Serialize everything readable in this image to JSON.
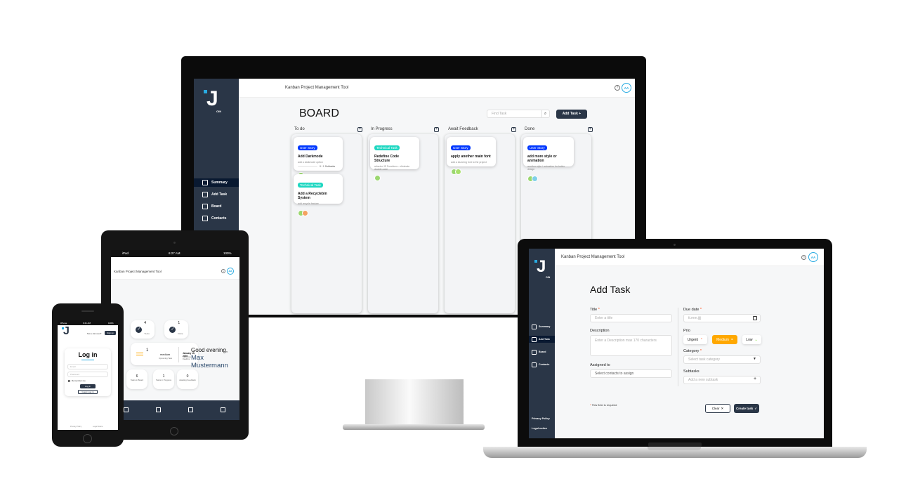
{
  "colors": {
    "sidebar": "#2a3647",
    "accent": "#29abe2",
    "user_story": "#0038ff",
    "technical_task": "#1fd7c1",
    "medium": "#ffa800"
  },
  "app": {
    "title": "Kanban Project Management Tool",
    "logo_text": "OIN",
    "user_initials": "AA",
    "help": "?"
  },
  "desktop": {
    "nav": [
      {
        "label": "Summary",
        "icon": "summary-icon"
      },
      {
        "label": "Add Task",
        "icon": "add-task-icon"
      },
      {
        "label": "Board",
        "icon": "board-icon"
      },
      {
        "label": "Contacts",
        "icon": "contacts-icon"
      }
    ],
    "board_title": "BOARD",
    "search_placeholder": "Find Task",
    "add_task_button": "Add Task +",
    "columns": [
      {
        "title": "To do",
        "cards": [
          {
            "category": "User Story",
            "title": "Add Darkmode",
            "desc": "add a darkmode option",
            "progress": "0 / 1 Subtasks"
          },
          {
            "category": "Technical Task",
            "title": "Add a Recyclebin System",
            "desc": "add recycle feature"
          }
        ]
      },
      {
        "title": "In Progress",
        "cards": [
          {
            "category": "Technical Task",
            "title": "Redefine Code Structure",
            "desc": "refactor JS Functions - eliminate double code"
          }
        ]
      },
      {
        "title": "Await Feedback",
        "cards": [
          {
            "category": "User Story",
            "title": "apply another main font",
            "desc": "add a stunning font to the project"
          }
        ]
      },
      {
        "title": "Done",
        "cards": [
          {
            "category": "User Story",
            "title": "add more style or animation",
            "desc": "another style / animation for better design"
          }
        ]
      }
    ]
  },
  "tablet": {
    "status_left": "iPad",
    "status_time": "6:27 AM",
    "status_right": "100%",
    "tiles": [
      {
        "value": "4",
        "label": "To-do"
      },
      {
        "value": "1",
        "label": "Done"
      }
    ],
    "urgent": {
      "value": "1",
      "prio": "medium",
      "sub": "Upcoming Task",
      "date": "January 15, 2026",
      "date_sub": "Upcoming Deadline"
    },
    "stats": [
      {
        "value": "6",
        "label": "Tasks in Board"
      },
      {
        "value": "1",
        "label": "Tasks in Progress"
      },
      {
        "value": "0",
        "label": "Awaiting Feedback"
      }
    ],
    "greeting": "Good evening,",
    "name": "Max Mustermann"
  },
  "phone": {
    "status_left": "iPhone",
    "status_time": "9:41 AM",
    "status_right": "100%",
    "signup_prompt": "Not a Join user?",
    "signup_button": "Sign up",
    "title": "Log in",
    "email_placeholder": "Email",
    "password_placeholder": "Password",
    "remember": "Remember me",
    "login_button": "Log in",
    "guest_button": "Guest Log in",
    "footer": [
      "Privacy Policy",
      "Legal Notice"
    ]
  },
  "laptop": {
    "nav": [
      {
        "label": "Summary",
        "icon": "summary-icon"
      },
      {
        "label": "Add Task",
        "icon": "add-task-icon"
      },
      {
        "label": "Board",
        "icon": "board-icon"
      },
      {
        "label": "Contacts",
        "icon": "contacts-icon"
      }
    ],
    "footer_links": [
      "Privacy Policy",
      "Legal notice"
    ],
    "heading": "Add Task",
    "title_label": "Title",
    "title_placeholder": "Enter a title",
    "description_label": "Description",
    "description_placeholder": "Enter a Description max 170 characters",
    "assigned_label": "Assigned to",
    "assigned_placeholder": "Select contacts to assign",
    "due_label": "Due date",
    "due_placeholder": "tt.mm.jjjj",
    "prio_label": "Prio",
    "prio": [
      "Urgent",
      "Medium",
      "Low"
    ],
    "category_label": "Category",
    "category_placeholder": "Select task category",
    "subtasks_label": "Subtasks",
    "subtasks_placeholder": "Add a new subtask",
    "required_note": "This field is required",
    "clear_button": "Clear",
    "create_button": "Create task"
  }
}
